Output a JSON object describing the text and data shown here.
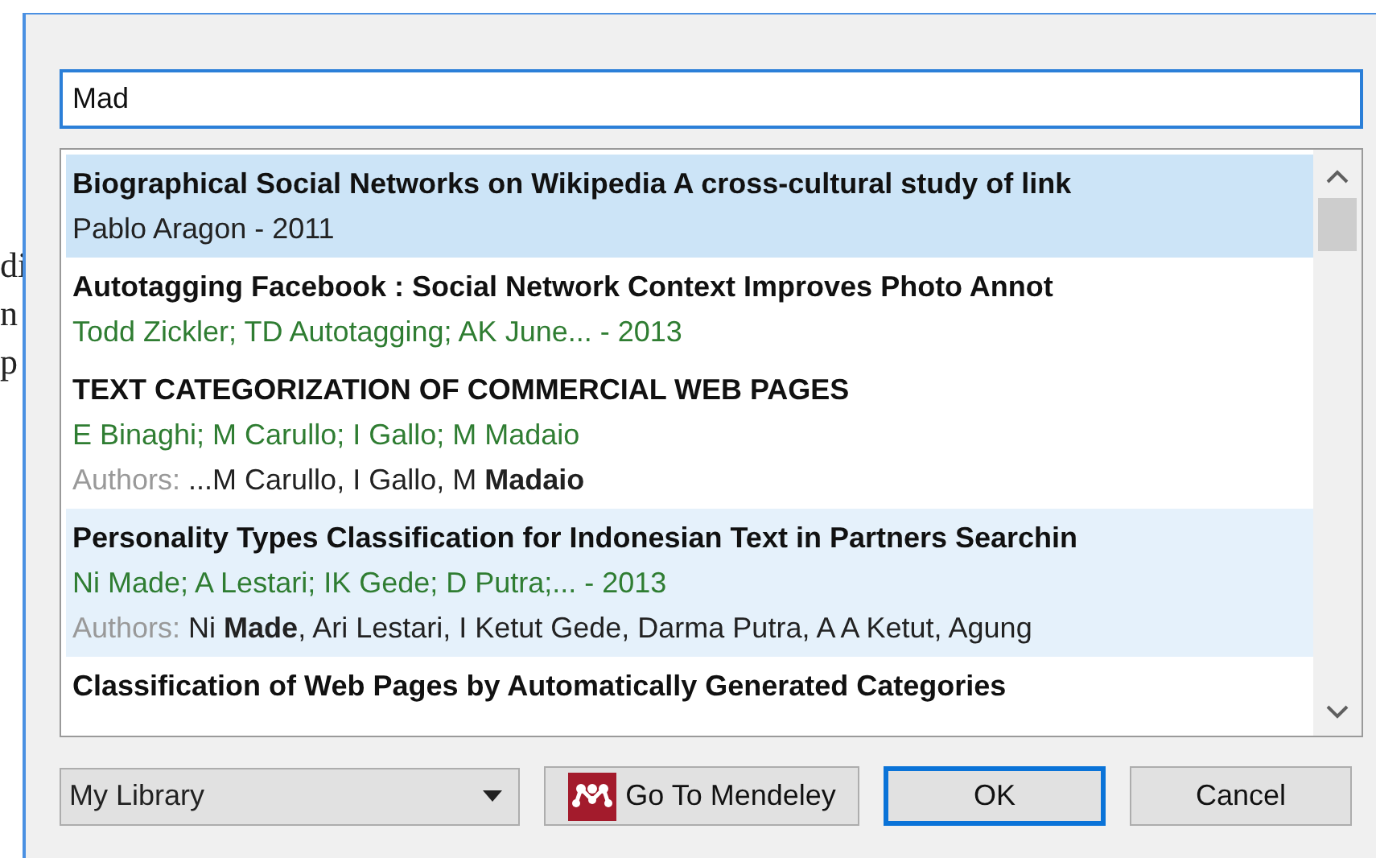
{
  "background_text": [
    "di",
    "n",
    "p"
  ],
  "search": {
    "value": "Mad"
  },
  "results": [
    {
      "title": "Biographical Social Networks on Wikipedia A cross-cultural study of link",
      "citation": "Pablo Aragon - 2011",
      "selected": true,
      "hovered": false
    },
    {
      "title": "Autotagging Facebook : Social Network Context Improves Photo Annot",
      "citation": "Todd Zickler; TD Autotagging; AK June... - 2013",
      "selected": false,
      "hovered": false
    },
    {
      "title": "TEXT CATEGORIZATION OF COMMERCIAL WEB PAGES",
      "citation": "E Binaghi; M Carullo; I Gallo; M Madaio",
      "match_label": "Authors:",
      "match": "...M Carullo, I Gallo, M **Madaio**",
      "selected": false,
      "hovered": false
    },
    {
      "title": "Personality Types Classification for Indonesian Text in Partners Searchin",
      "citation": "Ni Made; A Lestari; IK Gede; D Putra;... - 2013",
      "match_label": "Authors:",
      "match": "Ni **Made**, Ari Lestari, I Ketut Gede, Darma Putra, A A Ketut, Agung",
      "selected": false,
      "hovered": true
    },
    {
      "title": "Classification of Web Pages by Automatically Generated Categories",
      "selected": false,
      "hovered": false
    }
  ],
  "library_select": {
    "value": "My Library"
  },
  "buttons": [
    {
      "label": "Go To Mendeley",
      "kind": "mendeley",
      "default": false
    },
    {
      "label": "OK",
      "kind": "plain",
      "default": true
    },
    {
      "label": "Cancel",
      "kind": "plain",
      "default": false
    }
  ]
}
